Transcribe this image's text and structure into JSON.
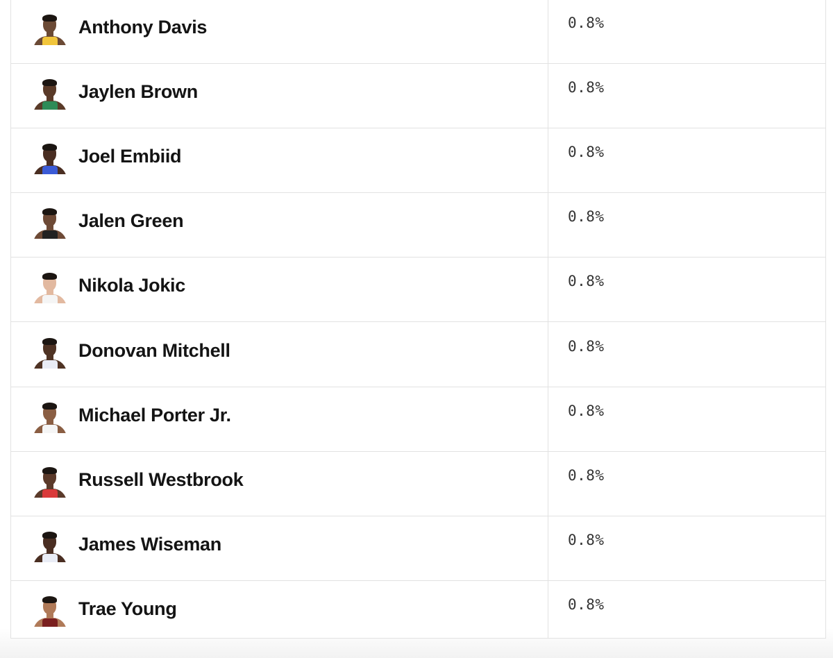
{
  "rows": [
    {
      "name": "Anthony Davis",
      "value": "0.8%",
      "skin": "#6b4a35",
      "jersey": "#f1c53b"
    },
    {
      "name": "Jaylen Brown",
      "value": "0.8%",
      "skin": "#5a3a28",
      "jersey": "#2e8b57"
    },
    {
      "name": "Joel Embiid",
      "value": "0.8%",
      "skin": "#4a2e22",
      "jersey": "#3b5bd6"
    },
    {
      "name": "Jalen Green",
      "value": "0.8%",
      "skin": "#6e4a36",
      "jersey": "#222222"
    },
    {
      "name": "Nikola Jokic",
      "value": "0.8%",
      "skin": "#e2b9a0",
      "jersey": "#f5f5f5"
    },
    {
      "name": "Donovan Mitchell",
      "value": "0.8%",
      "skin": "#4f3324",
      "jersey": "#e9ecf5"
    },
    {
      "name": "Michael Porter Jr.",
      "value": "0.8%",
      "skin": "#8a5e43",
      "jersey": "#f5f5f5"
    },
    {
      "name": "Russell Westbrook",
      "value": "0.8%",
      "skin": "#5b3a2a",
      "jersey": "#d93a3a"
    },
    {
      "name": "James Wiseman",
      "value": "0.8%",
      "skin": "#4a2e22",
      "jersey": "#e9ecf5"
    },
    {
      "name": "Trae Young",
      "value": "0.8%",
      "skin": "#b07a58",
      "jersey": "#7a1f1f"
    }
  ]
}
